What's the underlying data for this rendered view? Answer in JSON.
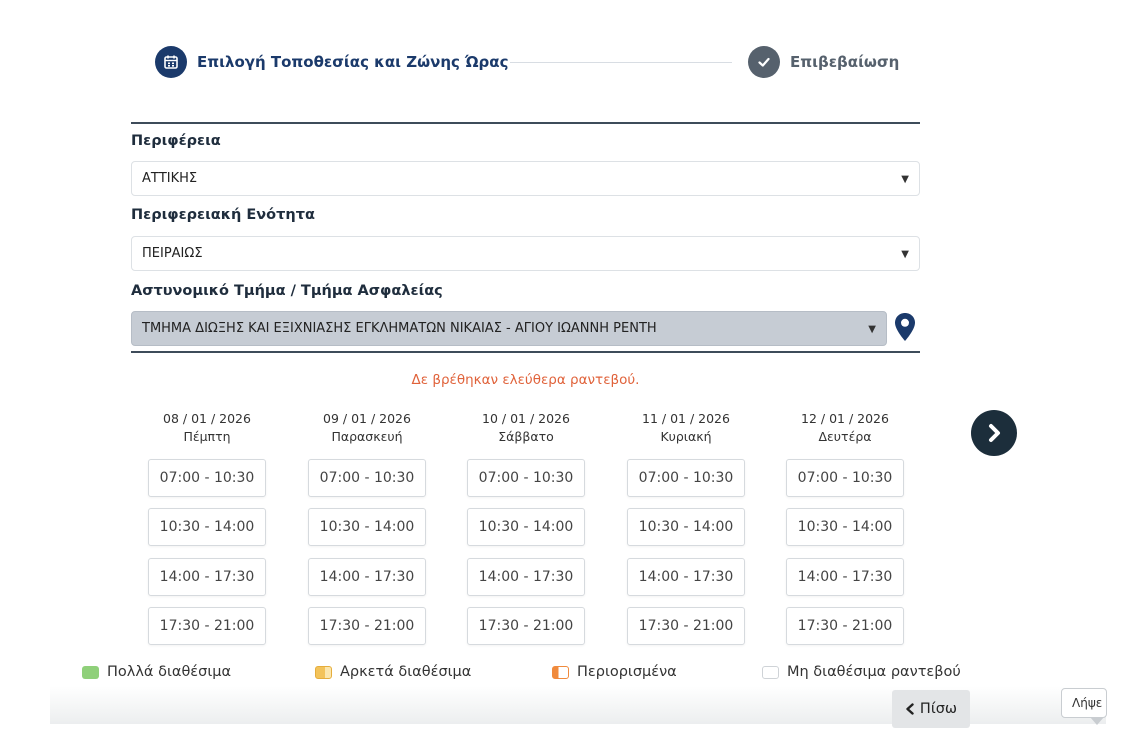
{
  "stepper": {
    "step1_label": "Επιλογή Τοποθεσίας και Ζώνης Ώρας",
    "step2_label": "Επιβεβαίωση",
    "step1_icon": "calendar-icon",
    "step2_icon": "check-icon"
  },
  "form": {
    "region_label": "Περιφέρεια",
    "region_value": "ΑΤΤΙΚΗΣ",
    "unit_label": "Περιφερειακή Ενότητα",
    "unit_value": "ΠΕΙΡΑΙΩΣ",
    "station_label": "Αστυνομικό Τμήμα / Τμήμα Ασφαλείας",
    "station_value": "ΤΜΗΜΑ ΔΙΩΞΗΣ ΚΑΙ ΕΞΙΧΝΙΑΣΗΣ ΕΓΚΛΗΜΑΤΩΝ ΝΙΚΑΙΑΣ - ΑΓΙΟΥ ΙΩΑΝΝΗ ΡΕΝΤΗ",
    "caret": "▼",
    "location_icon": "map-pin-icon"
  },
  "message": "Δε βρέθηκαν ελεύθερα ραντεβού.",
  "days": [
    {
      "date": "08 / 01 / 2026",
      "weekday": "Πέμπτη",
      "slots": [
        "07:00 - 10:30",
        "10:30 - 14:00",
        "14:00 - 17:30",
        "17:30 - 21:00"
      ]
    },
    {
      "date": "09 / 01 / 2026",
      "weekday": "Παρασκευή",
      "slots": [
        "07:00 - 10:30",
        "10:30 - 14:00",
        "14:00 - 17:30",
        "17:30 - 21:00"
      ]
    },
    {
      "date": "10 / 01 / 2026",
      "weekday": "Σάββατο",
      "slots": [
        "07:00 - 10:30",
        "10:30 - 14:00",
        "14:00 - 17:30",
        "17:30 - 21:00"
      ]
    },
    {
      "date": "11 / 01 / 2026",
      "weekday": "Κυριακή",
      "slots": [
        "07:00 - 10:30",
        "10:30 - 14:00",
        "14:00 - 17:30",
        "17:30 - 21:00"
      ]
    },
    {
      "date": "12 / 01 / 2026",
      "weekday": "Δευτέρα",
      "slots": [
        "07:00 - 10:30",
        "10:30 - 14:00",
        "14:00 - 17:30",
        "17:30 - 21:00"
      ]
    }
  ],
  "next_icon": "chevron-right-icon",
  "legend": [
    {
      "label": "Πολλά διαθέσιμα",
      "color": "#8fd07a"
    },
    {
      "label": "Αρκετά διαθέσιμα",
      "color": "#f3c35a"
    },
    {
      "label": "Περιορισμένα",
      "color": "#f08a3c"
    },
    {
      "label": "Μη διαθέσιμα ραντεβού",
      "color": "#ffffff"
    }
  ],
  "footer": {
    "back_label": "Πίσω",
    "back_icon": "chevron-left-icon",
    "tooltip_text": "Λήψε"
  },
  "colors": {
    "primary": "#1b3a6b",
    "message": "#e0623a"
  }
}
